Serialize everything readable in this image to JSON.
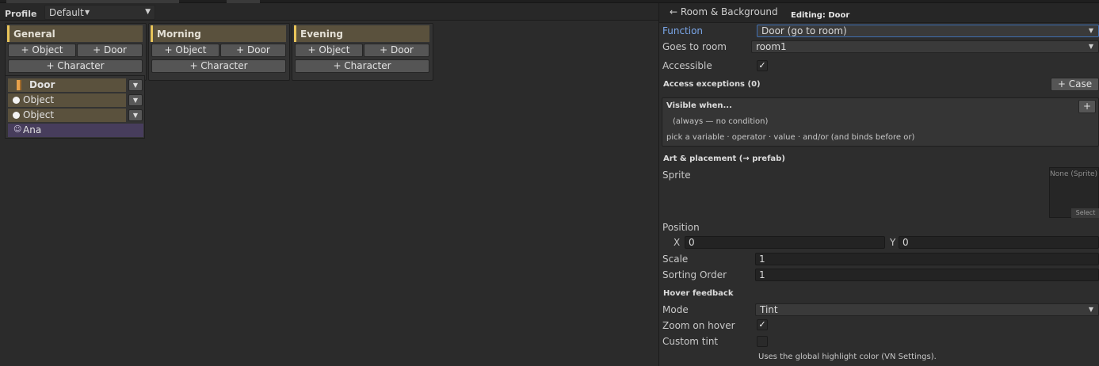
{
  "toolbar": {
    "profile_label": "Profile",
    "profile_value": "Default"
  },
  "groups": [
    {
      "name": "General",
      "add_object": "+ Object",
      "add_door": "+ Door",
      "add_character": "+ Character"
    },
    {
      "name": "Morning",
      "add_object": "+ Object",
      "add_door": "+ Door",
      "add_character": "+ Character"
    },
    {
      "name": "Evening",
      "add_object": "+ Object",
      "add_door": "+ Door",
      "add_character": "+ Character"
    }
  ],
  "items": [
    {
      "label": "Door",
      "type": "door"
    },
    {
      "label": "Object",
      "type": "object"
    },
    {
      "label": "Object",
      "type": "object"
    },
    {
      "label": "Ana",
      "type": "character"
    }
  ],
  "inspector": {
    "back_label": "← Room & Background",
    "editing_label": "Editing: Door",
    "function_label": "Function",
    "function_value": "Door (go to room)",
    "goes_to_label": "Goes to room",
    "goes_to_value": "room1",
    "accessible_label": "Accessible",
    "accessible_checked": true,
    "access_exceptions_label": "Access exceptions (0)",
    "add_case_label": "+ Case",
    "visible_when_label": "Visible when...",
    "add_condition_label": "+",
    "visible_condition_text": "(always — no condition)",
    "visible_hint_text": "pick a variable · operator · value · and/or  (and binds before or)",
    "art_section_label": "Art & placement (→ prefab)",
    "sprite_label": "Sprite",
    "sprite_value": "None (Sprite)",
    "sprite_select_label": "Select",
    "position_label": "Position",
    "x_label": "X",
    "x_value": "0",
    "y_label": "Y",
    "y_value": "0",
    "scale_label": "Scale",
    "scale_value": "1",
    "sorting_label": "Sorting Order",
    "sorting_value": "1",
    "hover_section_label": "Hover feedback",
    "mode_label": "Mode",
    "mode_value": "Tint",
    "zoom_label": "Zoom on hover",
    "zoom_checked": true,
    "custom_tint_label": "Custom tint",
    "custom_tint_checked": false,
    "tint_hint_text": "Uses the global highlight color (VN Settings)."
  },
  "colors": {
    "group_accent": "#e8c45a",
    "object_row": "#5a513d",
    "character_row": "#473d5c",
    "active_label": "#7aa6e8"
  }
}
